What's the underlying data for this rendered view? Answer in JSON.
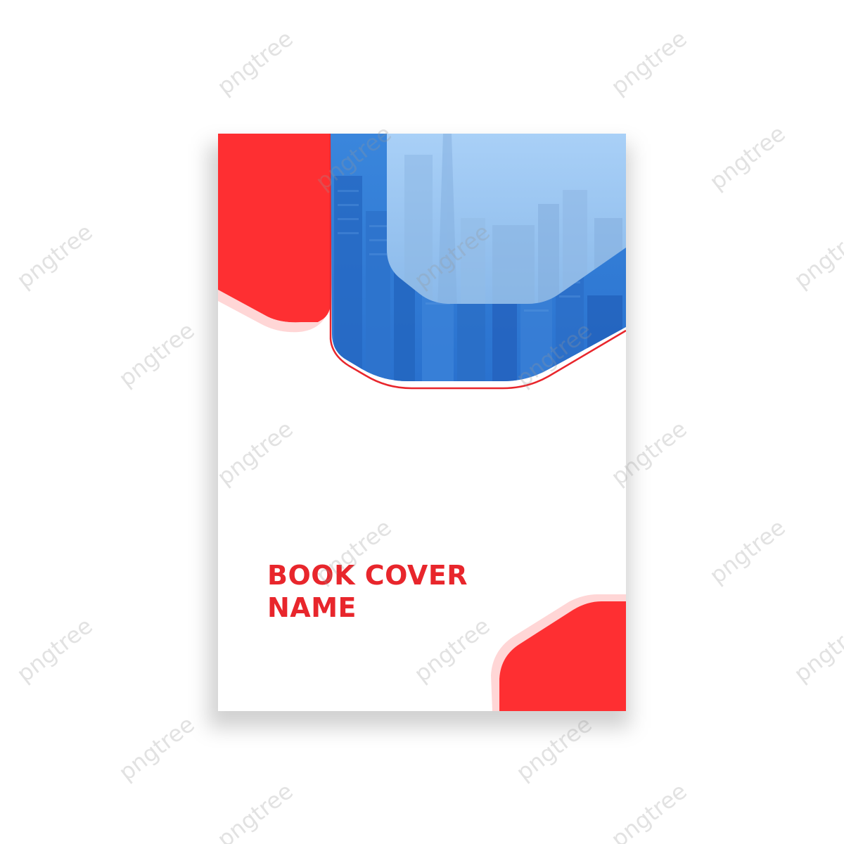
{
  "cover": {
    "title_line1": "BOOK COVER",
    "title_line2": "NAME"
  },
  "colors": {
    "accent_red": "#fe2f32",
    "primary_blue": "#2f7fd8",
    "light_blue": "#9cc6f2",
    "title_red": "#e8262c"
  },
  "watermark": {
    "text": "pngtree"
  }
}
